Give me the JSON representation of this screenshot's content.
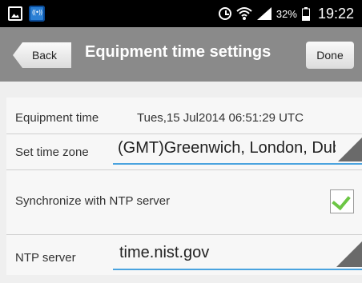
{
  "status_bar": {
    "battery_percent": "32%",
    "time": "19:22",
    "icons": [
      "image-icon",
      "app-icon",
      "alarm-icon",
      "wifi-icon",
      "signal-icon",
      "battery-icon"
    ]
  },
  "titlebar": {
    "back_label": "Back",
    "title": "Equipment time settings",
    "done_label": "Done"
  },
  "settings": {
    "equipment_time": {
      "label": "Equipment time",
      "value": "Tues,15 Jul2014 06:51:29   UTC"
    },
    "time_zone": {
      "label": "Set time zone",
      "value": "(GMT)Greenwich, London, Dublin, Lisbon"
    },
    "ntp_sync": {
      "label": "Synchronize with NTP server",
      "checked": true
    },
    "ntp_server": {
      "label": "NTP server",
      "value": "time.nist.gov"
    }
  },
  "colors": {
    "status_bar_bg": "#000000",
    "titlebar_bg": "#8a8a8a",
    "spinner_underline": "#4aa3df",
    "check_green": "#6cc644"
  }
}
